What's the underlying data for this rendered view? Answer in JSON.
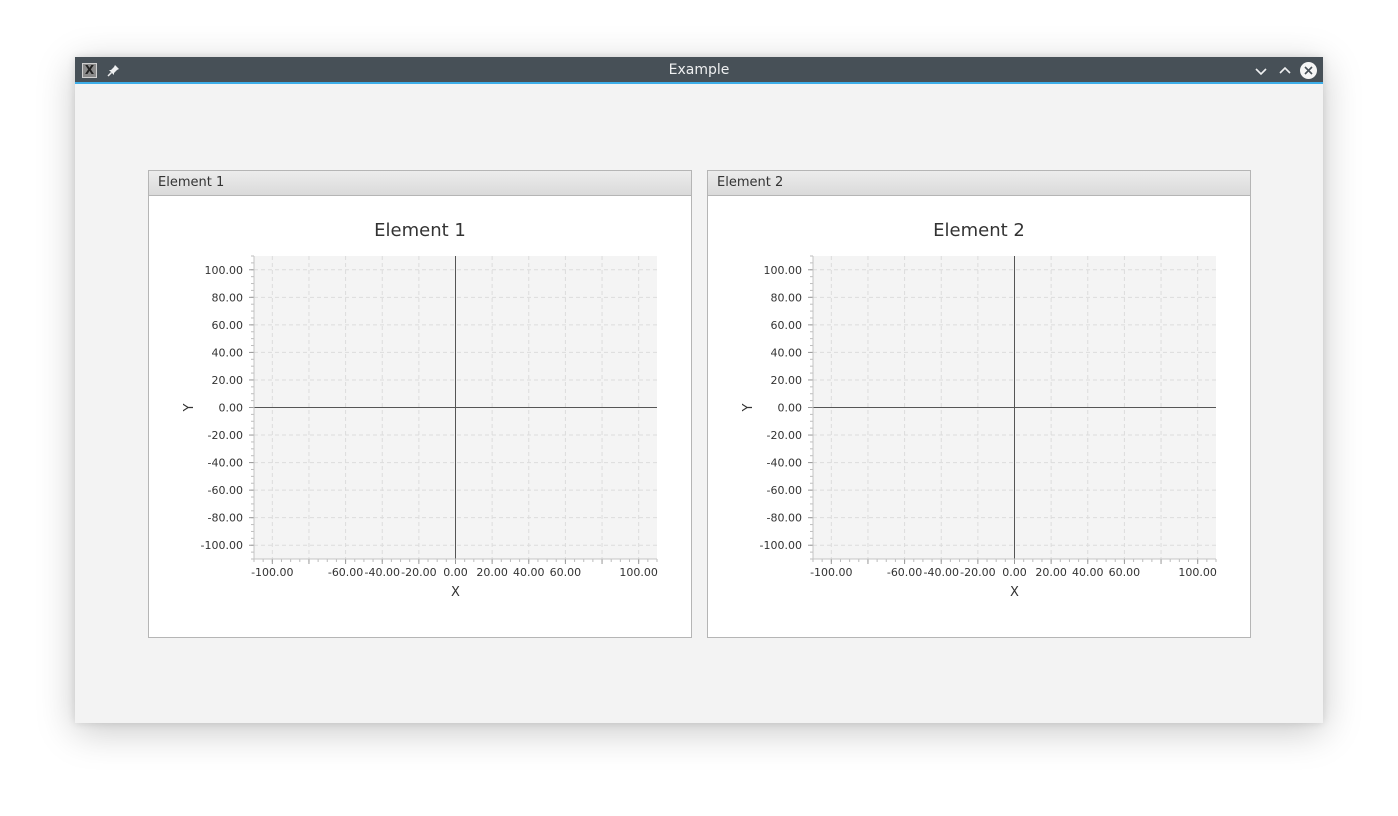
{
  "window": {
    "title": "Example"
  },
  "panels": [
    {
      "header": "Element 1"
    },
    {
      "header": "Element 2"
    }
  ],
  "chart_data": [
    {
      "type": "scatter",
      "title": "Element 1",
      "xlabel": "X",
      "ylabel": "Y",
      "xlim": [
        -110,
        110
      ],
      "ylim": [
        -110,
        110
      ],
      "x_ticks": [
        "-100.00",
        "-60.00",
        "-40.00",
        "-20.00",
        "0.00",
        "20.00",
        "40.00",
        "60.00",
        "100.00"
      ],
      "y_ticks": [
        "100.00",
        "80.00",
        "60.00",
        "40.00",
        "20.00",
        "0.00",
        "-20.00",
        "-40.00",
        "-60.00",
        "-80.00",
        "-100.00"
      ],
      "grid": true,
      "series": []
    },
    {
      "type": "scatter",
      "title": "Element 2",
      "xlabel": "X",
      "ylabel": "Y",
      "xlim": [
        -110,
        110
      ],
      "ylim": [
        -110,
        110
      ],
      "x_ticks": [
        "-100.00",
        "-60.00",
        "-40.00",
        "-20.00",
        "0.00",
        "20.00",
        "40.00",
        "60.00",
        "100.00"
      ],
      "y_ticks": [
        "100.00",
        "80.00",
        "60.00",
        "40.00",
        "20.00",
        "0.00",
        "-20.00",
        "-40.00",
        "-60.00",
        "-80.00",
        "-100.00"
      ],
      "grid": true,
      "series": []
    }
  ],
  "colors": {
    "titlebar": "#475057",
    "accent": "#3daee9",
    "plot_background": "#f4f4f4",
    "grid": "#dcdcdc",
    "axis": "#555555"
  }
}
